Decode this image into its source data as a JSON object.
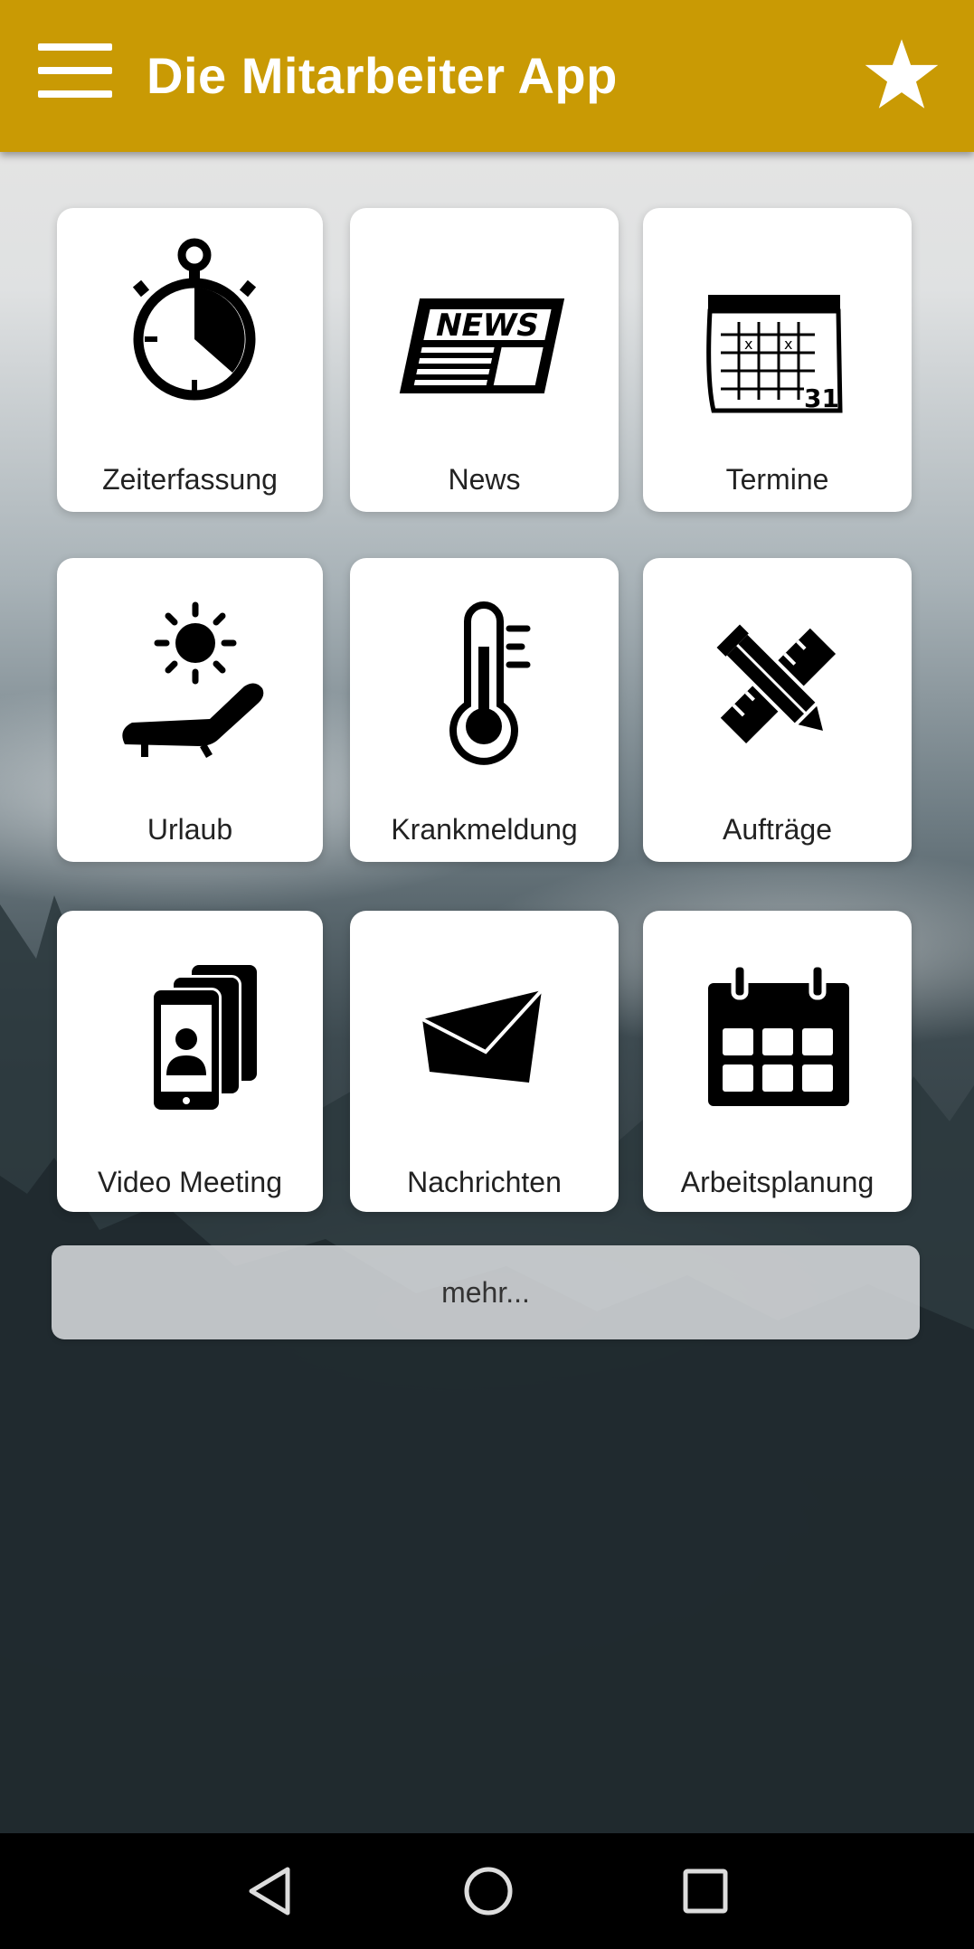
{
  "app_bar": {
    "title": "Die Mitarbeiter App",
    "menu_icon": "hamburger-menu-icon",
    "favorite_icon": "star-icon",
    "color": "#c99a04"
  },
  "tiles": [
    {
      "label": "Zeiterfassung",
      "icon": "stopwatch-icon"
    },
    {
      "label": "News",
      "icon": "newspaper-icon"
    },
    {
      "label": "Termine",
      "icon": "calendar-31-icon"
    },
    {
      "label": "Urlaub",
      "icon": "sun-lounger-icon"
    },
    {
      "label": "Krankmeldung",
      "icon": "thermometer-icon"
    },
    {
      "label": "Aufträge",
      "icon": "ruler-pencil-icon"
    },
    {
      "label": "Video Meeting",
      "icon": "phones-video-icon"
    },
    {
      "label": "Nachrichten",
      "icon": "envelope-icon"
    },
    {
      "label": "Arbeitsplanung",
      "icon": "calendar-grid-icon"
    }
  ],
  "more_button": {
    "label": "mehr..."
  },
  "system_nav": {
    "back_icon": "back-triangle-icon",
    "home_icon": "home-circle-icon",
    "recents_icon": "recents-square-icon"
  }
}
